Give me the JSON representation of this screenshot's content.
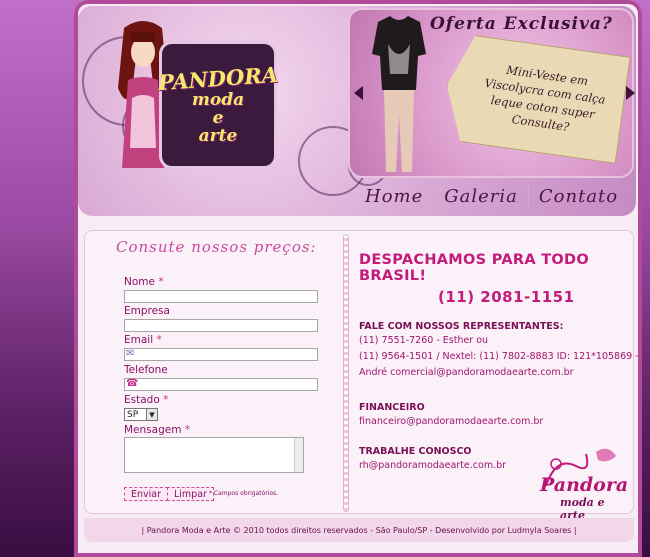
{
  "header": {
    "logo_title": "PANDORA",
    "logo_line2": "moda",
    "logo_line3": "e",
    "logo_line4": "arte",
    "offer_title": "Oferta Exclusiva?",
    "offer_tag_lines": [
      "Mini-Veste em",
      "Viscolycra com calça",
      "leque coton super",
      "Consulte?"
    ]
  },
  "nav": {
    "items": [
      "Home",
      "Galeria",
      "Contato"
    ]
  },
  "form": {
    "title": "Consute nossos preços:",
    "nome_label": "Nome",
    "empresa_label": "Empresa",
    "email_label": "Email",
    "telefone_label": "Telefone",
    "estado_label": "Estado",
    "estado_value": "SP",
    "mensagem_label": "Mensagem",
    "required_mark": "*",
    "send_button": "Enviar",
    "clear_button": "Limpar",
    "required_note": "* Campos obrigatórios."
  },
  "info": {
    "title": "DESPACHAMOS PARA TODO BRASIL!",
    "phone": "(11) 2081-1151",
    "reps_head": "FALE COM NOSSOS REPRESENTANTES:",
    "reps_line1": "(11) 7551-7260 - Esther ou",
    "reps_line2": "(11) 9564-1501 / Nextel: (11) 7802-8883 ID: 121*105869 -",
    "reps_line3": "André comercial@pandoramodaearte.com.br",
    "financeiro_head": "FINANCEIRO",
    "financeiro_email": "financeiro@pandoramodaearte.com.br",
    "trabalhe_head": "TRABALHE CONOSCO",
    "trabalhe_email": "rh@pandoramodaearte.com.br"
  },
  "footer_logo": {
    "line1": "Pandora",
    "line2": "moda e arte"
  },
  "footer": {
    "text": "| Pandora Moda e Arte © 2010 todos direitos reservados - São Paulo/SP - Desenvolvido por Ludmyla Soares |"
  },
  "colors": {
    "accent": "#c31b7c",
    "dark_purple": "#3a1238",
    "background": "#f7ecf4"
  }
}
